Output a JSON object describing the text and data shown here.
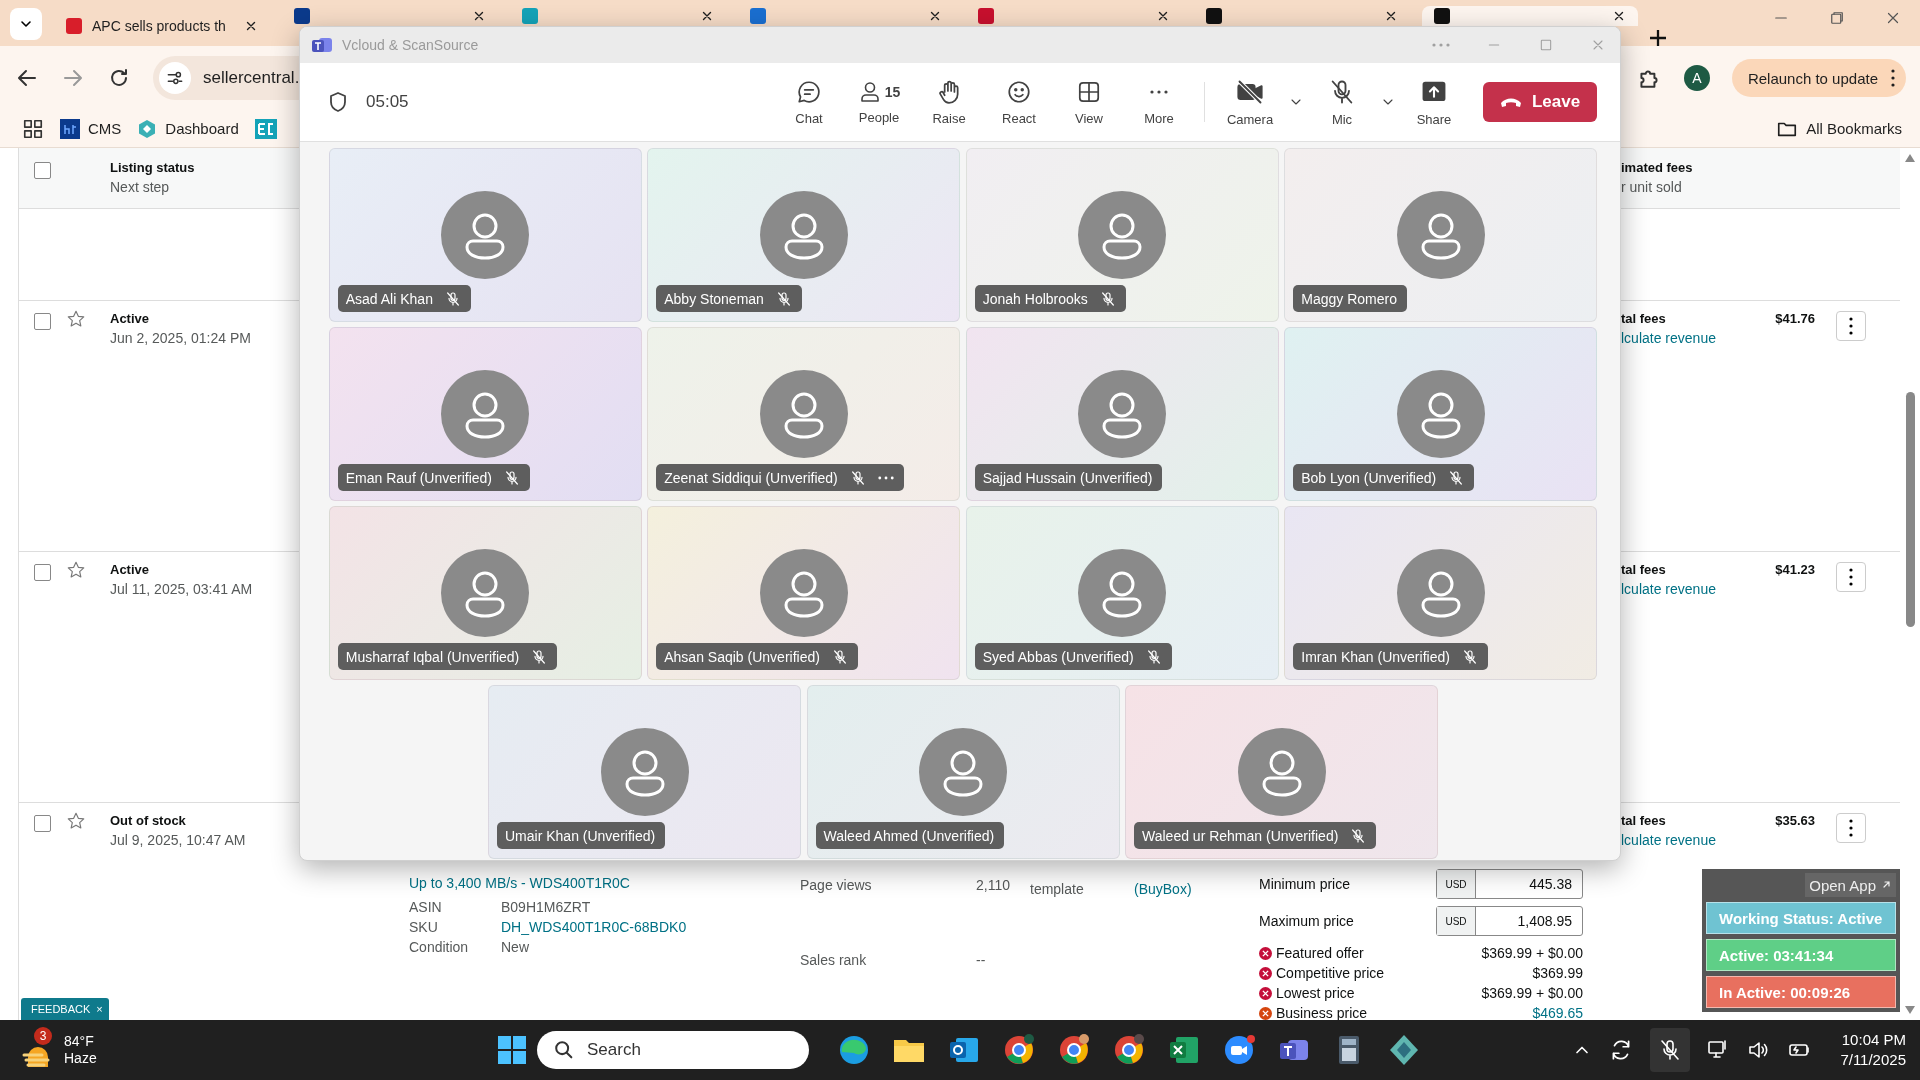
{
  "browser": {
    "tabs": [
      {
        "title": "APC sells products th",
        "selected": false
      },
      {
        "selected": false
      },
      {
        "selected": false
      },
      {
        "selected": false
      },
      {
        "selected": false
      },
      {
        "selected": false
      },
      {
        "selected": true
      }
    ],
    "address": "sellercentral.",
    "avatar": "A",
    "relaunch": "Relaunch to update",
    "bookmarks": [
      {
        "label": "CMS"
      },
      {
        "label": "Dashboard"
      }
    ],
    "all_bookmarks": "All Bookmarks"
  },
  "listing": {
    "header": {
      "checked": false,
      "title": "Listing status",
      "subtitle": "Next step",
      "fees_title": "imated fees",
      "fees_subtitle": "r unit sold"
    },
    "rows": [
      {
        "checked": false,
        "starred": false,
        "status": "Active",
        "date": "Jun 2, 2025, 01:24 PM",
        "fees_label": "tal fees",
        "fees_link": "lculate revenue",
        "price": "$41.76"
      },
      {
        "checked": false,
        "starred": false,
        "status": "Active",
        "date": "Jul 11, 2025, 03:41 AM",
        "fees_label": "tal fees",
        "fees_link": "lculate revenue",
        "price": "$41.23"
      },
      {
        "checked": false,
        "starred": false,
        "status": "Out of stock",
        "date": "Jul 9, 2025, 10:47 AM",
        "fees_label": "tal fees",
        "fees_link": "lculate revenue",
        "price": "$35.63"
      }
    ],
    "detail": {
      "title": "Up to 3,400 MB/s - WDS400T1R0C",
      "attributes": [
        {
          "label": "ASIN",
          "value": "B09H1M6ZRT",
          "kind": "text"
        },
        {
          "label": "SKU",
          "value": "DH_WDS400T1R0C-68BDK0",
          "kind": "link"
        },
        {
          "label": "Condition",
          "value": "New",
          "kind": "text"
        }
      ],
      "stats": [
        {
          "label": "Page views",
          "value": "2,110"
        },
        {
          "label": "Sales rank",
          "value": "--"
        }
      ],
      "template": "template",
      "buybox": "(BuyBox)",
      "prices": [
        {
          "label": "Minimum price",
          "currency": "USD",
          "value": "445.38"
        },
        {
          "label": "Maximum price",
          "currency": "USD",
          "value": "1,408.95"
        }
      ],
      "offers": [
        {
          "label": "Featured offer",
          "value": "$369.99 + $0.00",
          "color": "#c40f3a",
          "kind": "text"
        },
        {
          "label": "Competitive price",
          "value": "$369.99",
          "color": "#c40f3a",
          "kind": "text"
        },
        {
          "label": "Lowest price",
          "value": "$369.99 + $0.00",
          "color": "#c40f3a",
          "kind": "text"
        },
        {
          "label": "Business price",
          "value": "$469.65",
          "color": "#d5460f",
          "kind": "link"
        }
      ]
    }
  },
  "feedback": {
    "label": "FEEDBACK",
    "close": "×"
  },
  "meeting": {
    "title": "Vcloud & ScanSource",
    "timer": "05:05",
    "controls": [
      {
        "kind": "chat",
        "label": "Chat"
      },
      {
        "kind": "people",
        "label": "People",
        "count": "15"
      },
      {
        "kind": "raise",
        "label": "Raise"
      },
      {
        "kind": "react",
        "label": "React"
      },
      {
        "kind": "view",
        "label": "View"
      },
      {
        "kind": "more",
        "label": "More"
      },
      {
        "kind": "camera",
        "label": "Camera",
        "on": false
      },
      {
        "kind": "mic",
        "label": "Mic",
        "on": false
      },
      {
        "kind": "share",
        "label": "Share"
      }
    ],
    "leave": "Leave",
    "participants": [
      {
        "name": "Asad Ali Khan",
        "muted": true,
        "menu": false
      },
      {
        "name": "Abby Stoneman",
        "muted": true,
        "menu": false
      },
      {
        "name": "Jonah Holbrooks",
        "muted": true,
        "menu": false
      },
      {
        "name": "Maggy Romero",
        "muted": false,
        "menu": false
      },
      {
        "name": "Eman Rauf (Unverified)",
        "muted": true,
        "menu": false
      },
      {
        "name": "Zeenat Siddiqui (Unverified)",
        "muted": true,
        "menu": true
      },
      {
        "name": "Sajjad Hussain (Unverified)",
        "muted": false,
        "menu": false
      },
      {
        "name": "Bob Lyon (Unverified)",
        "muted": true,
        "menu": false
      },
      {
        "name": "Musharraf Iqbal (Unverified)",
        "muted": true,
        "menu": false
      },
      {
        "name": "Ahsan Saqib (Unverified)",
        "muted": true,
        "menu": false
      },
      {
        "name": "Syed Abbas (Unverified)",
        "muted": true,
        "menu": false
      },
      {
        "name": "Imran Khan (Unverified)",
        "muted": true,
        "menu": false
      },
      {
        "name": "Umair Khan (Unverified)",
        "muted": false,
        "menu": false
      },
      {
        "name": "Waleed Ahmed (Unverified)",
        "muted": false,
        "menu": false
      },
      {
        "name": "Waleed ur Rehman (Unverified)",
        "muted": true,
        "menu": false
      }
    ]
  },
  "tracker": {
    "open_app": "Open App",
    "statuses": [
      {
        "label": "Working Status: Active",
        "color": "#6fc3d2"
      },
      {
        "label": "Active: 03:41:34",
        "color": "#5fcf87"
      },
      {
        "label": "In Active: 00:09:26",
        "color": "#e8705f"
      }
    ]
  },
  "taskbar": {
    "weather": {
      "badge": "3",
      "temperature": "84°F",
      "condition": "Haze"
    },
    "search": "Search",
    "time": "10:04 PM",
    "date": "7/11/2025"
  }
}
